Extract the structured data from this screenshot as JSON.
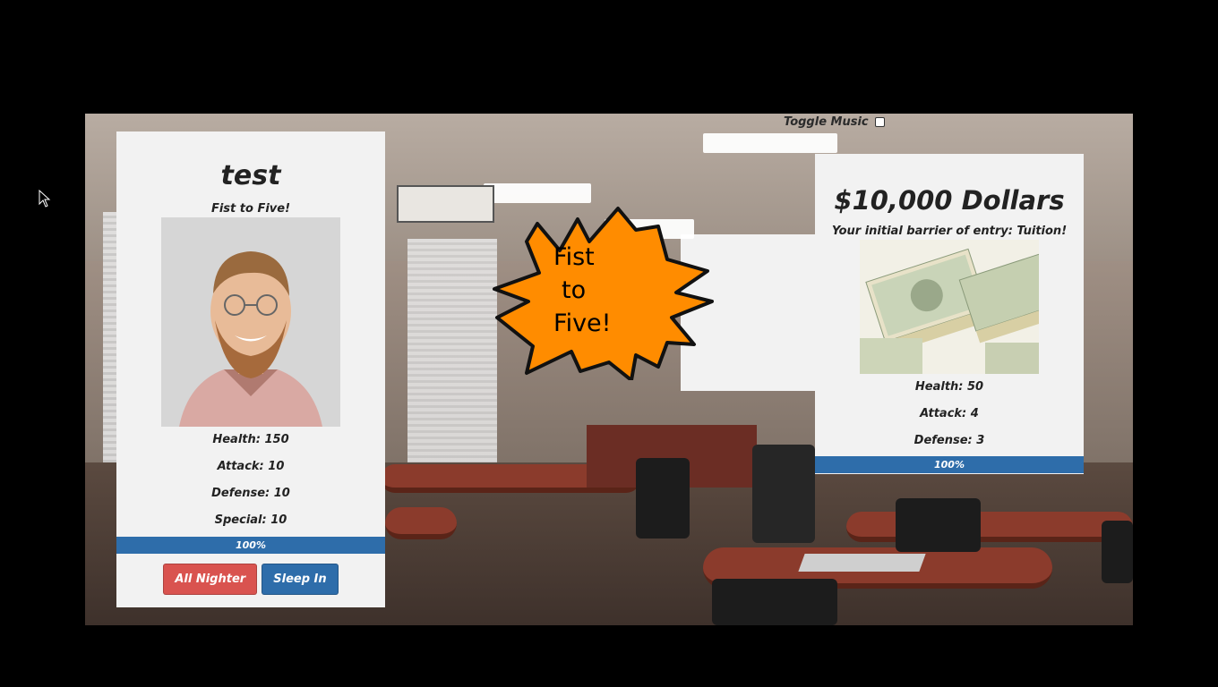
{
  "player": {
    "name": "test",
    "tagline": "Fist to Five!",
    "stats": [
      "Health: 150",
      "Attack: 10",
      "Defense: 10",
      "Special: 10"
    ],
    "health_bar_label": "100%",
    "health_fraction": 1.0,
    "actions": [
      {
        "label": "All Nighter",
        "color": "#d9534f"
      },
      {
        "label": "Sleep In",
        "color": "#2e6daa"
      }
    ]
  },
  "enemy": {
    "name": "$10,000 Dollars",
    "tagline": "Your initial barrier of entry: Tuition!",
    "stats": [
      "Health: 50",
      "Attack: 4",
      "Defense: 3"
    ],
    "health_bar_label": "100%",
    "health_fraction": 1.0
  },
  "burst": {
    "lines": [
      "Fist",
      "to",
      "Five!"
    ],
    "fill": "#ff8c00"
  },
  "music_toggle": {
    "label": "Toggle Music",
    "checked": false
  }
}
